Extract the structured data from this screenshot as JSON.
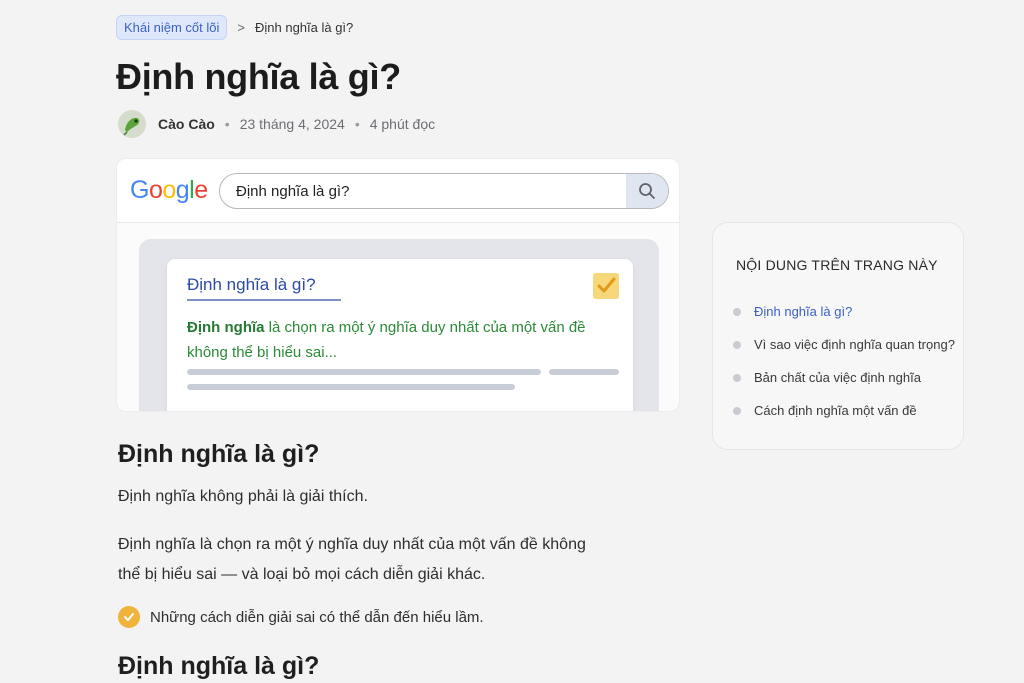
{
  "breadcrumb": {
    "parent": "Khái niệm cốt lõi",
    "separator": ">",
    "current": "Định nghĩa là gì?"
  },
  "page_title": "Định nghĩa là gì?",
  "meta": {
    "author": "Cào Cào",
    "date": "23 tháng 4, 2024",
    "read_time": "4 phút đọc",
    "separator": "•"
  },
  "hero": {
    "logo": [
      "G",
      "o",
      "o",
      "g",
      "l",
      "e"
    ],
    "logo_colors": [
      "#4285F4",
      "#EA4335",
      "#FBBC05",
      "#4285F4",
      "#34A853",
      "#EA4335"
    ],
    "search_query": "Định nghĩa là gì?",
    "result_title": "Định nghĩa là gì?",
    "result_snippet_bold": "Định nghĩa",
    "result_snippet_rest": " là chọn ra một ý nghĩa duy nhất của một vấn đề không thể bị hiểu sai...",
    "checkbox_checked": true
  },
  "article": {
    "h2_1": "Định nghĩa là gì?",
    "p1": "Định nghĩa không phải là giải thích.",
    "p2": "Định nghĩa là chọn ra một ý nghĩa duy nhất của một vấn đề không thể bị hiểu sai — và loại bỏ mọi cách diễn giải khác.",
    "note": "Những cách diễn giải sai có thể dẫn đến hiểu lầm.",
    "h2_2": "Định nghĩa là gì?"
  },
  "toc": {
    "title": "NỘI DUNG TRÊN TRANG NÀY",
    "items": [
      {
        "label": "Định nghĩa là gì?",
        "active": true
      },
      {
        "label": "Vì sao việc định nghĩa quan trọng?",
        "active": false
      },
      {
        "label": "Bản chất của việc định nghĩa",
        "active": false
      },
      {
        "label": "Cách định nghĩa một vấn đề",
        "active": false
      }
    ]
  },
  "colors": {
    "accent": "#3a5fc7",
    "snippet_green": "#2b8a37",
    "note_orange": "#f0b33b",
    "checkbox_yellow": "#f6d77a"
  }
}
